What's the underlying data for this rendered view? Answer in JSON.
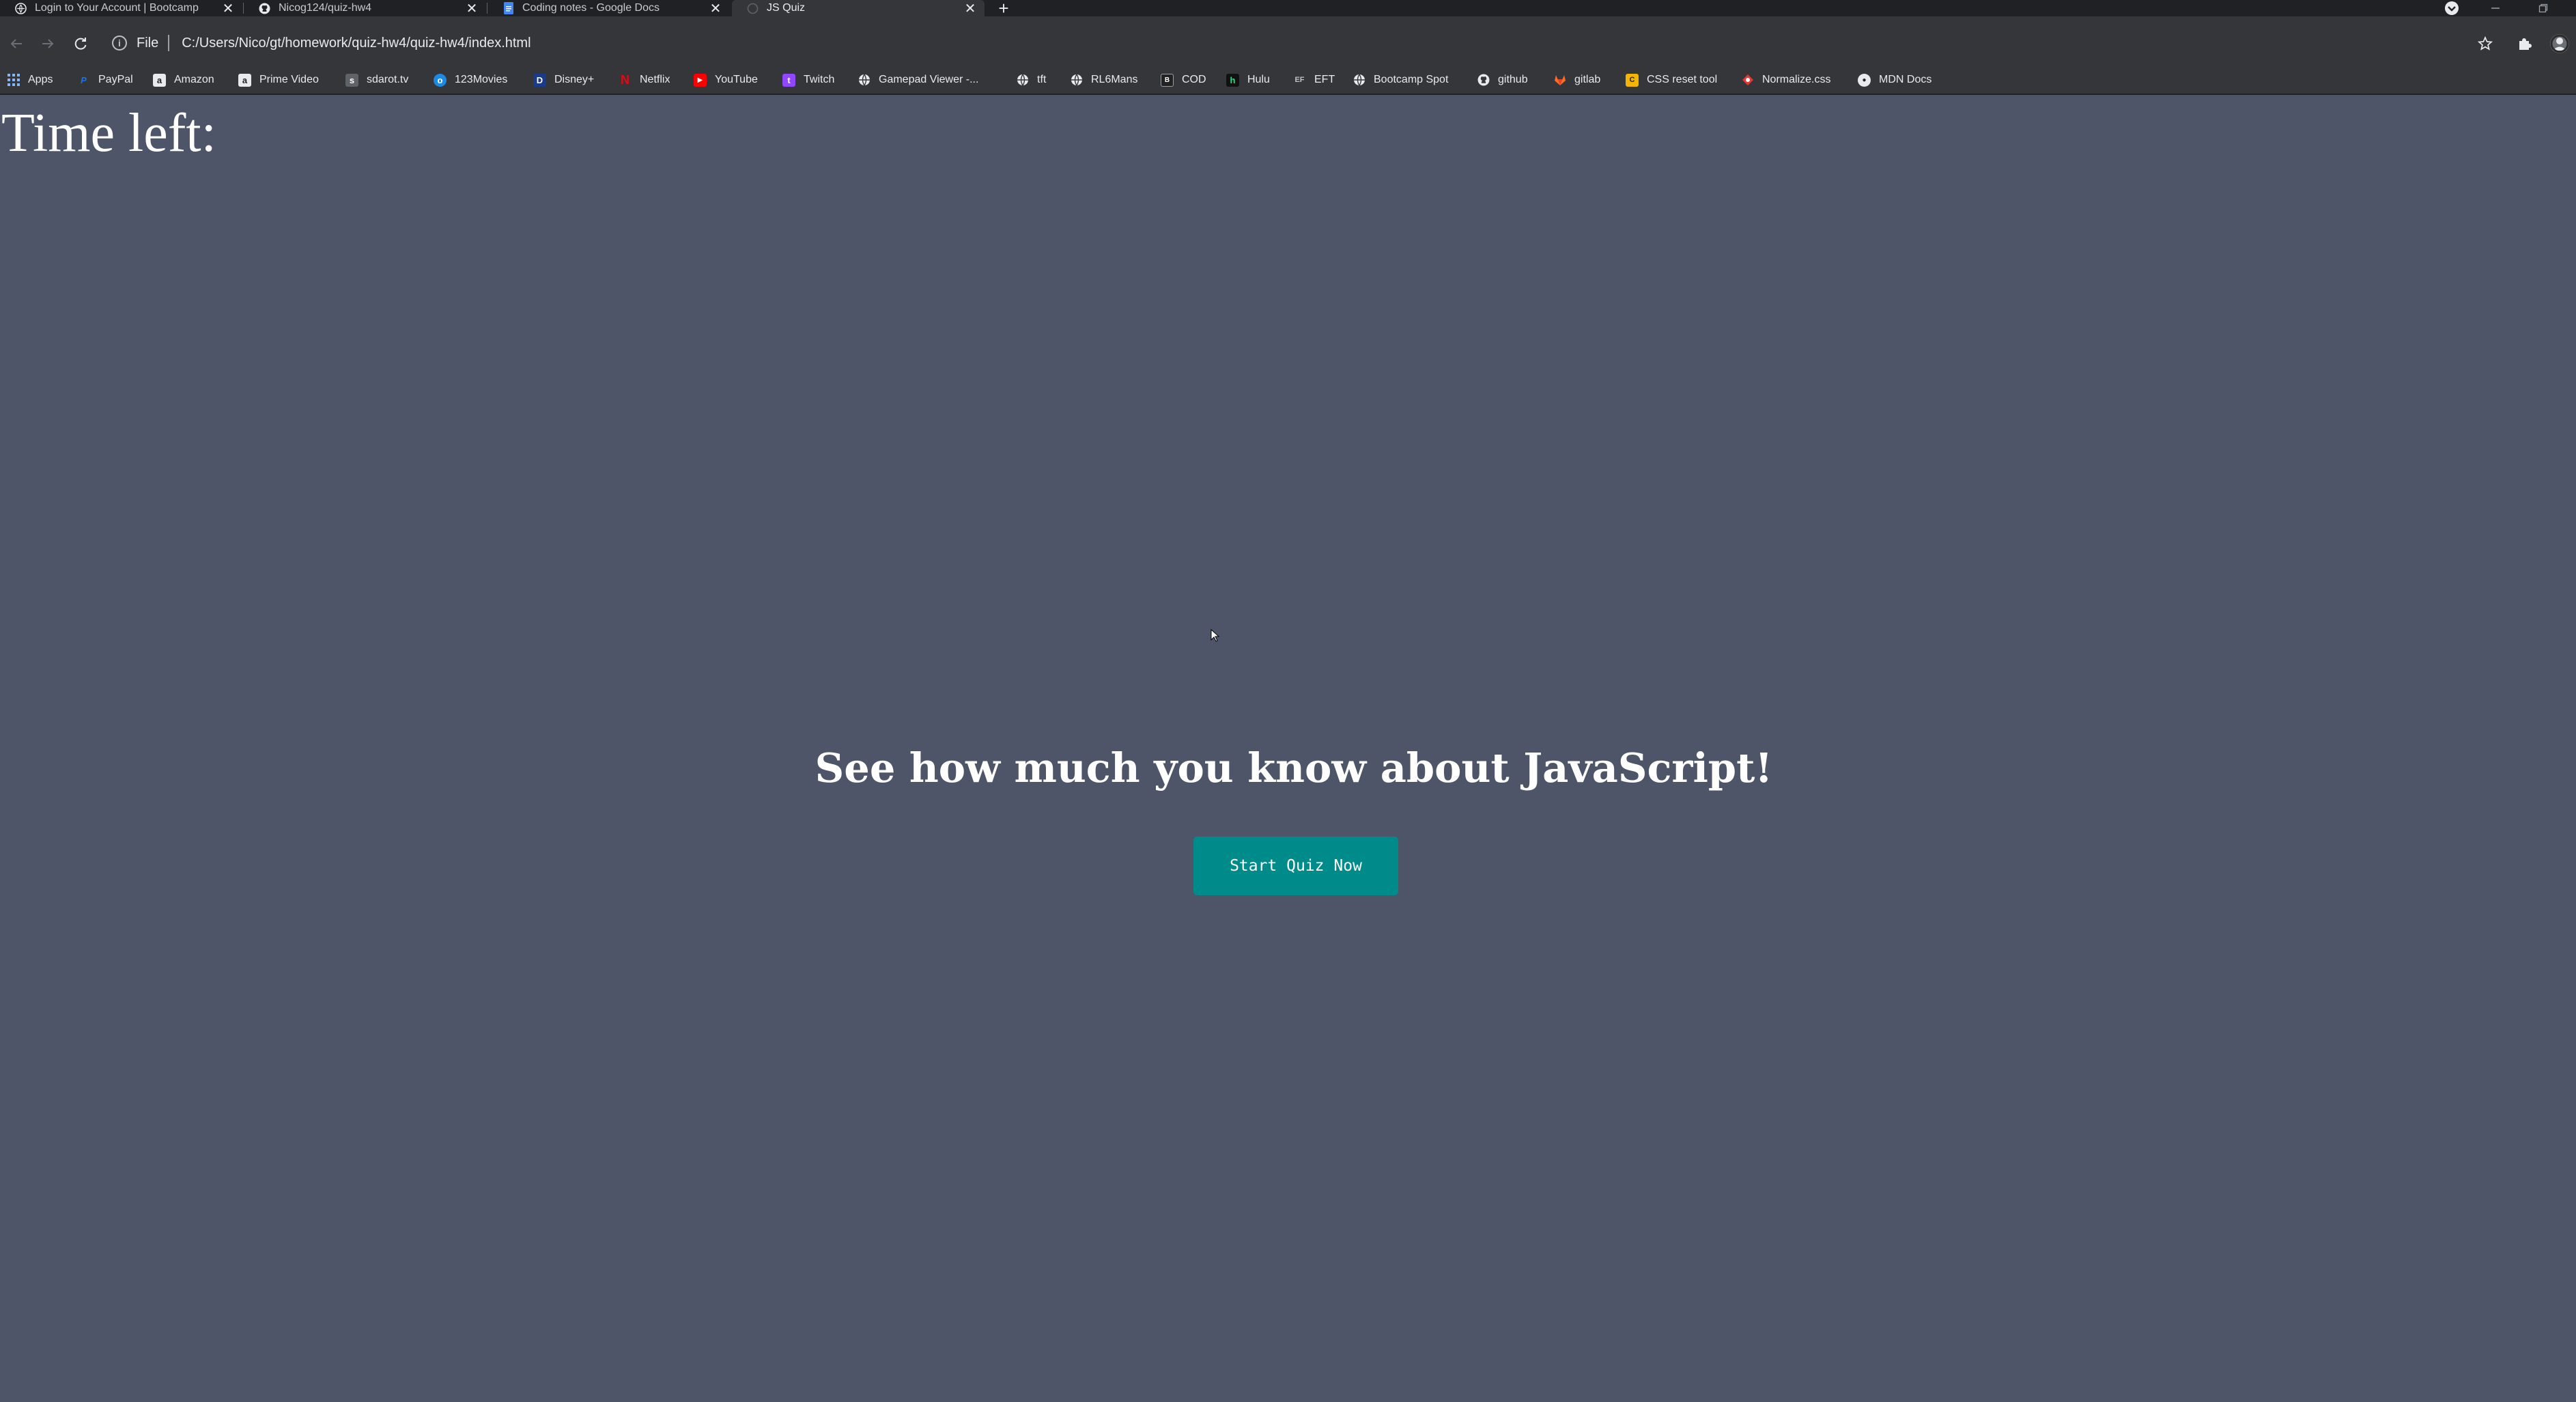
{
  "tabs": [
    {
      "title": "Login to Your Account | Bootcamp",
      "active": false,
      "icon": "bootcamp-icon"
    },
    {
      "title": "Nicog124/quiz-hw4",
      "active": false,
      "icon": "github-icon"
    },
    {
      "title": "Coding notes - Google Docs",
      "active": false,
      "icon": "google-docs-icon"
    },
    {
      "title": "JS Quiz",
      "active": true,
      "icon": "page-icon"
    }
  ],
  "address_bar": {
    "scheme": "File",
    "url": "C:/Users/Nico/gt/homework/quiz-hw4/quiz-hw4/index.html"
  },
  "bookmarks": [
    {
      "label": "Apps",
      "icon": "apps-grid-icon",
      "color": "#8ab4f8"
    },
    {
      "label": "PayPal",
      "icon": "paypal-icon",
      "color": "#1a73e8"
    },
    {
      "label": "Amazon",
      "icon": "amazon-icon",
      "color": "#e8eaed"
    },
    {
      "label": "Prime Video",
      "icon": "prime-video-icon",
      "color": "#e8eaed"
    },
    {
      "label": "sdarot.tv",
      "icon": "sdarot-icon",
      "color": "#5f6368"
    },
    {
      "label": "123Movies",
      "icon": "123movies-icon",
      "color": "#1e88e5"
    },
    {
      "label": "Disney+",
      "icon": "disney-icon",
      "color": "#1a3a8a"
    },
    {
      "label": "Netflix",
      "icon": "netflix-icon",
      "color": "#e50914"
    },
    {
      "label": "YouTube",
      "icon": "youtube-icon",
      "color": "#ff0000"
    },
    {
      "label": "Twitch",
      "icon": "twitch-icon",
      "color": "#9146ff"
    },
    {
      "label": "Gamepad Viewer -...",
      "icon": "globe-icon",
      "color": "#e8eaed"
    },
    {
      "label": "tft",
      "icon": "globe-icon",
      "color": "#e8eaed"
    },
    {
      "label": "RL6Mans",
      "icon": "globe-icon",
      "color": "#e8eaed"
    },
    {
      "label": "COD",
      "icon": "cod-icon",
      "color": "#222222"
    },
    {
      "label": "Hulu",
      "icon": "hulu-icon",
      "color": "#1ce783"
    },
    {
      "label": "EFT",
      "icon": "eft-icon",
      "color": "#9aa0a6"
    },
    {
      "label": "Bootcamp Spot",
      "icon": "globe-icon",
      "color": "#e8eaed"
    },
    {
      "label": "github",
      "icon": "github-icon",
      "color": "#e8eaed"
    },
    {
      "label": "gitlab",
      "icon": "gitlab-icon",
      "color": "#fc6d26"
    },
    {
      "label": "CSS reset tool",
      "icon": "css-reset-icon",
      "color": "#f4b400"
    },
    {
      "label": "Normalize.css",
      "icon": "normalize-icon",
      "color": "#e53935"
    },
    {
      "label": "MDN Docs",
      "icon": "mdn-icon",
      "color": "#e8eaed"
    }
  ],
  "page": {
    "timer_label": "Time left:",
    "headline": "See how much you know about JavaScript!",
    "start_button": "Start Quiz Now",
    "button_color": "#008b8b",
    "background_color": "#4f5568"
  }
}
